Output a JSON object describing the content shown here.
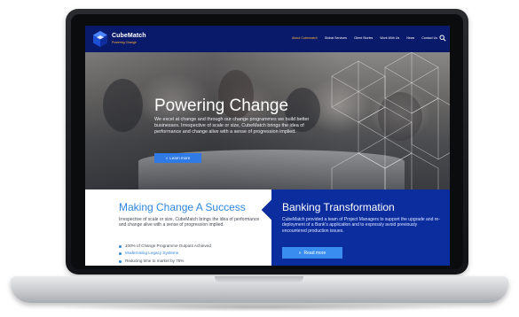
{
  "brand": {
    "name": "CubeMatch",
    "tagline": "Powering Change"
  },
  "nav": {
    "items": [
      {
        "label": "About Cubematch",
        "active": true
      },
      {
        "label": "Global Services",
        "active": false
      },
      {
        "label": "Client Stories",
        "active": false
      },
      {
        "label": "Work With Us",
        "active": false
      },
      {
        "label": "News",
        "active": false
      },
      {
        "label": "Contact Us",
        "active": false
      }
    ],
    "search_icon": "search-icon"
  },
  "hero": {
    "title": "Powering Change",
    "text": "We excel at change and through our change programmes we build better businesses. Irrespective of scale or size, CubeMatch brings the idea of performance and change alive with a sense of progression implied.",
    "button_label": "Learn more",
    "button_icon": "double-arrow-icon"
  },
  "left_panel": {
    "title": "Making Change A Success",
    "text": "Irrespective of scale or size, CubeMatch brings the idea of performance and change alive with a sense of progression implied.",
    "bullets": [
      "100% of Change Programme Outputs Achieved",
      "Modernising Legacy Systems",
      "Reducing time to market by 75%"
    ]
  },
  "right_panel": {
    "title": "Banking Transformation",
    "text": "CubeMatch provided a team of Project Managers to support the upgrade and re-deployment of a Bank's application and to expressly avoid previously encountered production issues.",
    "button_label": "Read more",
    "button_icon": "double-arrow-icon"
  },
  "colors": {
    "nav_bg": "#0a1a6a",
    "accent_orange": "#ffb33a",
    "accent_blue": "#2f86e0",
    "panel_blue": "#0b2d9e",
    "button_blue": "#3a8df0"
  }
}
